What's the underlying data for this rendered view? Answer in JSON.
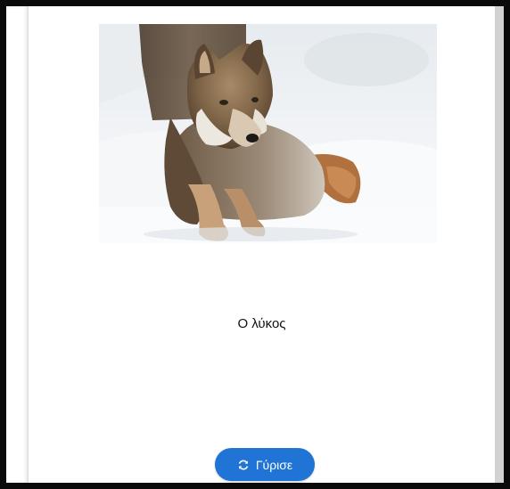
{
  "card": {
    "image_subject": "wolf-lying-in-snow",
    "caption": "Ο λύκος"
  },
  "flip_button": {
    "label": "Γύρισε",
    "icon": "sync-icon",
    "color": "#1f74d6"
  }
}
